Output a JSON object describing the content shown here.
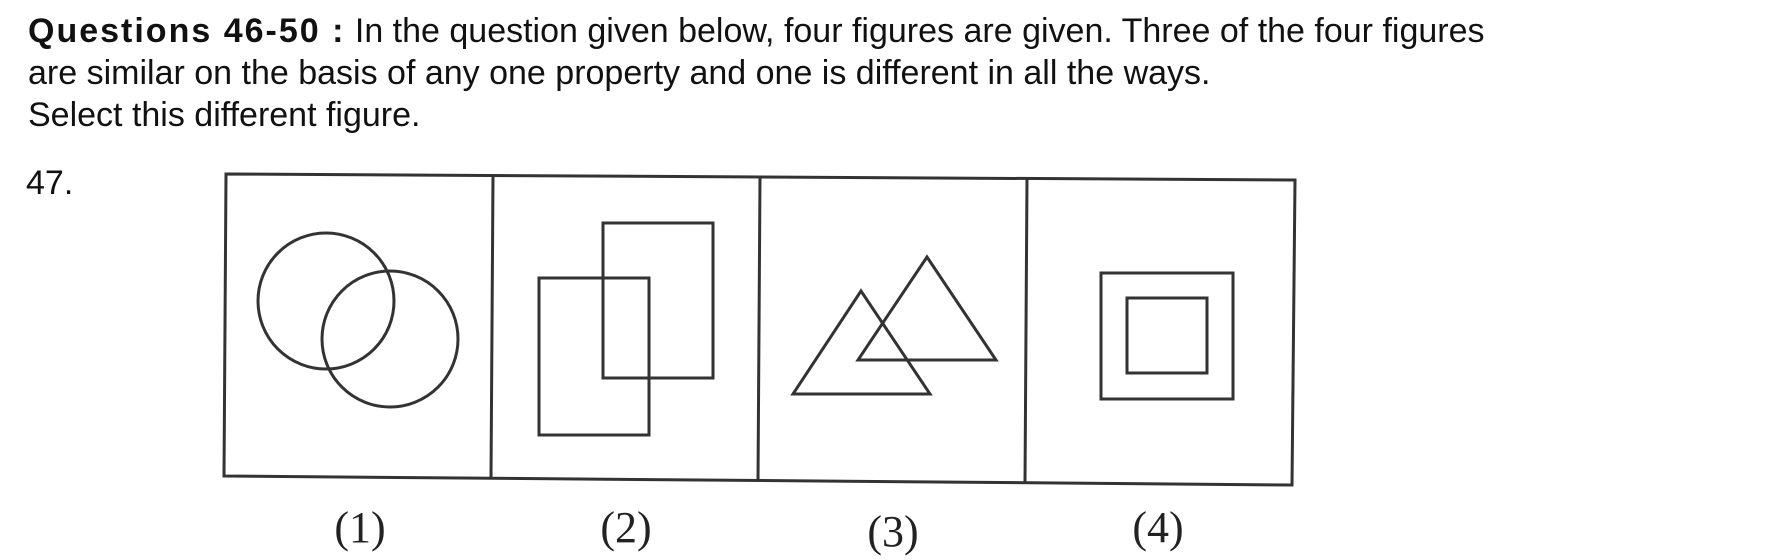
{
  "question_block": {
    "heading": "Questions 46-50 :",
    "instruction_line1": " In the question given below, four figures are given. Three of the four figures",
    "instruction_line2": "are similar on the basis of any one property and one is different in all the ways.",
    "instruction_line3": "Select this different figure.",
    "question_number": "47."
  },
  "figures": [
    {
      "label": "(1)",
      "shape": "two-overlapping-circles"
    },
    {
      "label": "(2)",
      "shape": "two-overlapping-rectangles"
    },
    {
      "label": "(3)",
      "shape": "two-overlapping-triangles"
    },
    {
      "label": "(4)",
      "shape": "nested-squares"
    }
  ]
}
